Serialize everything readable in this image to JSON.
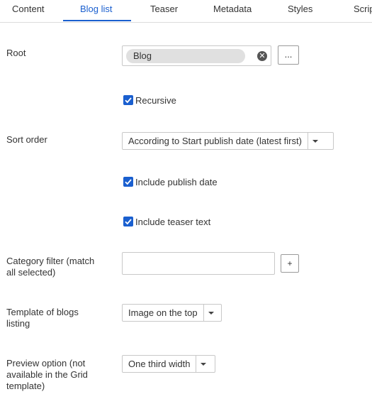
{
  "tabs": [
    "Content",
    "Blog list",
    "Teaser",
    "Metadata",
    "Styles",
    "Scrip"
  ],
  "active_tab": "Blog list",
  "root": {
    "label": "Root",
    "value": "Blog",
    "browse_label": "..."
  },
  "recursive": {
    "label": "Recursive",
    "checked": true
  },
  "sort_order": {
    "label": "Sort order",
    "value": "According to Start publish date (latest first)"
  },
  "include_publish_date": {
    "label": "Include publish date",
    "checked": true
  },
  "include_teaser_text": {
    "label": "Include teaser text",
    "checked": true
  },
  "category_filter": {
    "label_line1": "Category filter (match",
    "label_line2": "all selected)",
    "value": "",
    "add_label": "+"
  },
  "template": {
    "label_line1": "Template of blogs",
    "label_line2": "listing",
    "value": "Image on the top"
  },
  "preview": {
    "label_line1": "Preview option (not",
    "label_line2": "available in the Grid",
    "label_line3": "template)",
    "value": "One third width"
  },
  "colors": {
    "accent": "#1a5fcf",
    "chip_bg": "#e0e0e0",
    "border": "#c8c8c8"
  }
}
